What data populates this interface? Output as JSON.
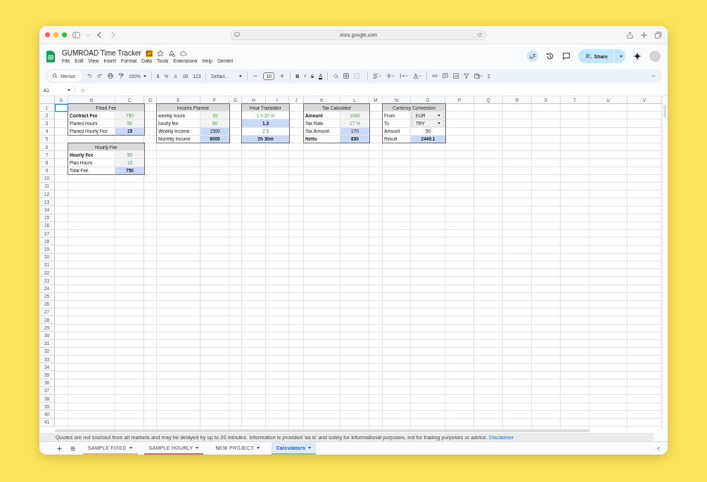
{
  "browser": {
    "address": "docs.google.com"
  },
  "document": {
    "title": "GUMROAD Time Tracker",
    "menu": [
      "File",
      "Edit",
      "View",
      "Insert",
      "Format",
      "Data",
      "Tools",
      "Extensions",
      "Help",
      "Gemini"
    ],
    "share": "Share"
  },
  "toolbar": {
    "search": "Menus",
    "zoom": "100%",
    "number_formats": [
      "$",
      "%",
      ".0",
      ".00",
      "123"
    ],
    "font": "Defaul...",
    "font_size": "10",
    "text_styles": [
      "B",
      "I",
      "S",
      "A"
    ],
    "functions": "Σ"
  },
  "formula_bar": {
    "cell_ref": "A1",
    "fx": "fx"
  },
  "sheet": {
    "columns": [
      "A",
      "B",
      "C",
      "D",
      "E",
      "F",
      "G",
      "H",
      "I",
      "J",
      "K",
      "L",
      "M",
      "N",
      "O",
      "P",
      "Q",
      "R",
      "S",
      "T",
      "U",
      "V"
    ],
    "rows": [
      "1",
      "2",
      "3",
      "4",
      "5",
      "6",
      "7",
      "8",
      "9",
      "10",
      "11",
      "12",
      "13",
      "14",
      "15",
      "16",
      "17",
      "18",
      "19",
      "20",
      "21",
      "22",
      "23",
      "24",
      "25",
      "26",
      "27",
      "28",
      "29",
      "30",
      "31",
      "32",
      "33",
      "34",
      "35",
      "36",
      "37",
      "38",
      "39",
      "40",
      "41"
    ],
    "tables": [
      {
        "title": "Fixed Fee",
        "rows": [
          [
            {
              "text": "Contract Fee",
              "kind": "label",
              "bold": true
            },
            {
              "text": "750",
              "kind": "input",
              "bold": false
            }
          ],
          [
            {
              "text": "Planed Hours",
              "kind": "label",
              "bold": false
            },
            {
              "text": "50",
              "kind": "input",
              "bold": false
            }
          ],
          [
            {
              "text": "Planed Hourly Fee",
              "kind": "label",
              "bold": false
            },
            {
              "text": "15",
              "kind": "result",
              "bold": true
            }
          ]
        ]
      },
      {
        "title": "Hourly Fee",
        "rows": [
          [
            {
              "text": "Hourly Fee",
              "kind": "label",
              "bold": true
            },
            {
              "text": "50",
              "kind": "input",
              "bold": false
            }
          ],
          [
            {
              "text": "Plan Hours",
              "kind": "label",
              "bold": false
            },
            {
              "text": "15",
              "kind": "input",
              "bold": false
            }
          ],
          [
            {
              "text": "Total Fee",
              "kind": "label",
              "bold": false
            },
            {
              "text": "750",
              "kind": "result",
              "bold": true
            }
          ]
        ]
      },
      {
        "title": "Income Planner",
        "rows": [
          [
            {
              "text": "weekly hours",
              "kind": "label",
              "bold": false
            },
            {
              "text": "30",
              "kind": "input",
              "bold": false
            }
          ],
          [
            {
              "text": "hourly fee",
              "kind": "label",
              "bold": false
            },
            {
              "text": "50",
              "kind": "input",
              "bold": false
            }
          ],
          [
            {
              "text": "Weekly Income",
              "kind": "label",
              "bold": false
            },
            {
              "text": "1500",
              "kind": "result",
              "bold": false
            }
          ],
          [
            {
              "text": "Monthly Income",
              "kind": "label",
              "bold": false
            },
            {
              "text": "6000",
              "kind": "result",
              "bold": true
            }
          ]
        ]
      },
      {
        "title": "Hour Translator",
        "rows": [
          [
            {
              "text": "1 h  20 m",
              "kind": "entry",
              "bold": false
            }
          ],
          [
            {
              "text": "1.3",
              "kind": "result",
              "bold": true
            }
          ],
          [
            {
              "text": "2.5",
              "kind": "entry",
              "bold": false
            }
          ],
          [
            {
              "text": "2h  30m",
              "kind": "result",
              "bold": true
            }
          ]
        ]
      },
      {
        "title": "Tax Calculator",
        "rows": [
          [
            {
              "text": "Amount",
              "kind": "label",
              "bold": true
            },
            {
              "text": "1000",
              "kind": "input",
              "bold": false
            }
          ],
          [
            {
              "text": "Tax Rate",
              "kind": "label",
              "bold": false
            },
            {
              "text": "17 %",
              "kind": "input",
              "bold": false
            }
          ],
          [
            {
              "text": "Tax Amount",
              "kind": "label",
              "bold": false
            },
            {
              "text": "170",
              "kind": "result",
              "bold": false
            }
          ],
          [
            {
              "text": "Netto",
              "kind": "label",
              "bold": true
            },
            {
              "text": "830",
              "kind": "result",
              "bold": true
            }
          ]
        ]
      },
      {
        "title": "Currency Conversion",
        "rows": [
          [
            {
              "text": "From",
              "kind": "label",
              "bold": false
            },
            {
              "text": "EUR",
              "kind": "dropdown",
              "bold": false
            }
          ],
          [
            {
              "text": "To",
              "kind": "label",
              "bold": false
            },
            {
              "text": "TRY",
              "kind": "dropdown",
              "bold": false
            }
          ],
          [
            {
              "text": "Amount",
              "kind": "label",
              "bold": false
            },
            {
              "text": "50",
              "kind": "value",
              "bold": false
            }
          ],
          [
            {
              "text": "Result",
              "kind": "label",
              "bold": false
            },
            {
              "text": "2449.1",
              "kind": "result",
              "bold": true
            }
          ]
        ]
      }
    ]
  },
  "notice": {
    "text": "Quotes are not sourced from all markets and may be delayed by up to 20 minutes. Information is provided 'as is' and solely for informational purposes, not for trading purposes or advice.",
    "link": "Disclaimer"
  },
  "sheet_tabs": [
    {
      "label": "SAMPLE FIXED",
      "selected": false,
      "color": "#f6b26b"
    },
    {
      "label": "SAMPLE HOURLY",
      "selected": false,
      "color": "#e06666"
    },
    {
      "label": "NEW PROJECT",
      "selected": false
    },
    {
      "label": "Calculators",
      "selected": true,
      "color": "#93c47d"
    }
  ]
}
